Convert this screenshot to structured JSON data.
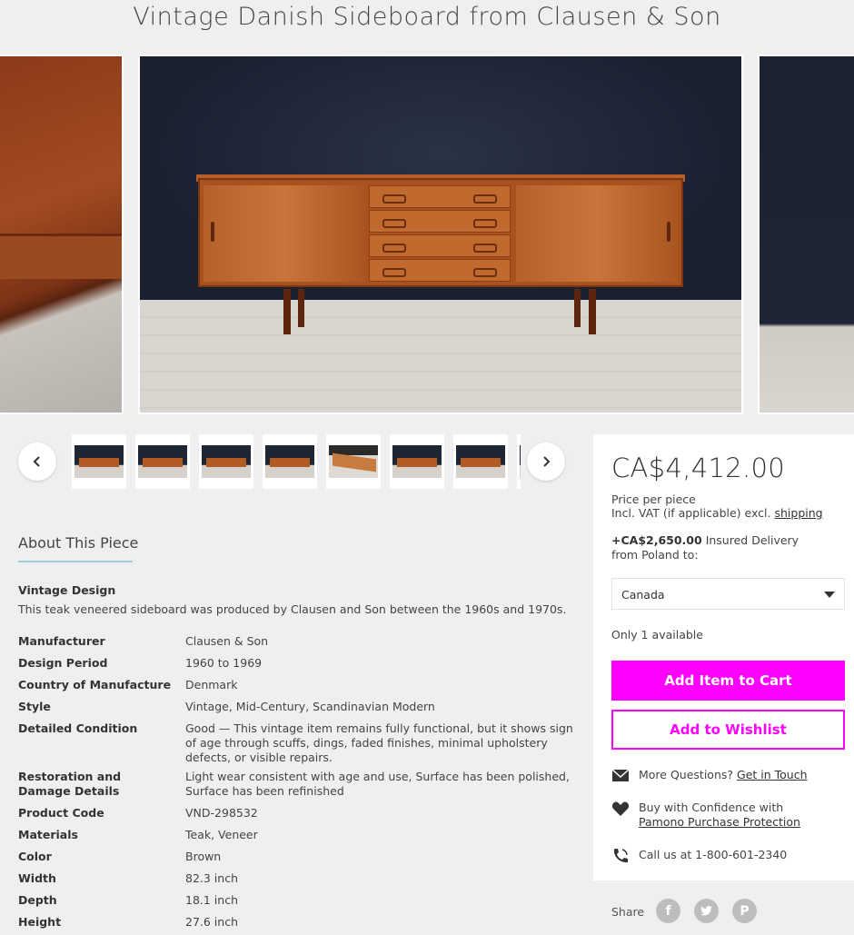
{
  "page_title": "Vintage Danish Sideboard from Clausen & Son",
  "gallery": {
    "prev_label": "previous image",
    "next_label": "next image",
    "thumbnails": [
      {
        "icon": "sideboard-photo"
      },
      {
        "icon": "sideboard-photo"
      },
      {
        "icon": "sideboard-photo"
      },
      {
        "icon": "sideboard-photo"
      },
      {
        "icon": "wood-detail-photo"
      },
      {
        "icon": "sideboard-photo"
      },
      {
        "icon": "sideboard-photo"
      }
    ]
  },
  "about": {
    "heading": "About This Piece",
    "design_heading": "Vintage Design",
    "design_text": "This teak veneered sideboard was produced by Clausen and Son between the 1960s and 1970s.",
    "specs": [
      {
        "label": "Manufacturer",
        "value": "Clausen & Son"
      },
      {
        "label": "Design Period",
        "value": "1960 to 1969"
      },
      {
        "label": "Country of Manufacture",
        "value": "Denmark"
      },
      {
        "label": "Style",
        "value": "Vintage, Mid-Century, Scandinavian Modern"
      },
      {
        "label": "Detailed Condition",
        "value": "Good — This vintage item remains fully functional, but it shows sign of age through scuffs, dings, faded finishes, minimal upholstery defects, or visible repairs."
      },
      {
        "label": "Restoration and Damage Details",
        "value": "Light wear consistent with age and use, Surface has been polished, Surface has been refinished"
      },
      {
        "label": "Product Code",
        "value": "VND-298532"
      },
      {
        "label": "Materials",
        "value": "Teak, Veneer"
      },
      {
        "label": "Color",
        "value": "Brown"
      },
      {
        "label": "Width",
        "value": "82.3 inch"
      },
      {
        "label": "Depth",
        "value": "18.1 inch"
      },
      {
        "label": "Height",
        "value": "27.6 inch"
      }
    ]
  },
  "purchase": {
    "price": "CA$4,412.00",
    "price_per_piece": "Price per piece",
    "vat_text": "Incl. VAT (if applicable) excl.",
    "vat_link": "shipping",
    "shipping_amount": "+CA$2,650.00",
    "shipping_text": "Insured Delivery",
    "shipping_from": "from Poland to:",
    "country_selected": "Canada",
    "availability": "Only 1 available",
    "add_to_cart": "Add Item to Cart",
    "add_to_wishlist": "Add to Wishlist",
    "questions_text": "More Questions?",
    "questions_link": "Get in Touch",
    "confidence_text": "Buy with Confidence with",
    "confidence_link": "Pamono Purchase Protection",
    "call_text": "Call us at 1-800-601-2340"
  },
  "share": {
    "label": "Share",
    "networks": [
      "facebook",
      "twitter",
      "pinterest"
    ]
  },
  "colors": {
    "accent": "#ff00ff",
    "underline": "#9ccfd8",
    "background": "#efefef"
  }
}
